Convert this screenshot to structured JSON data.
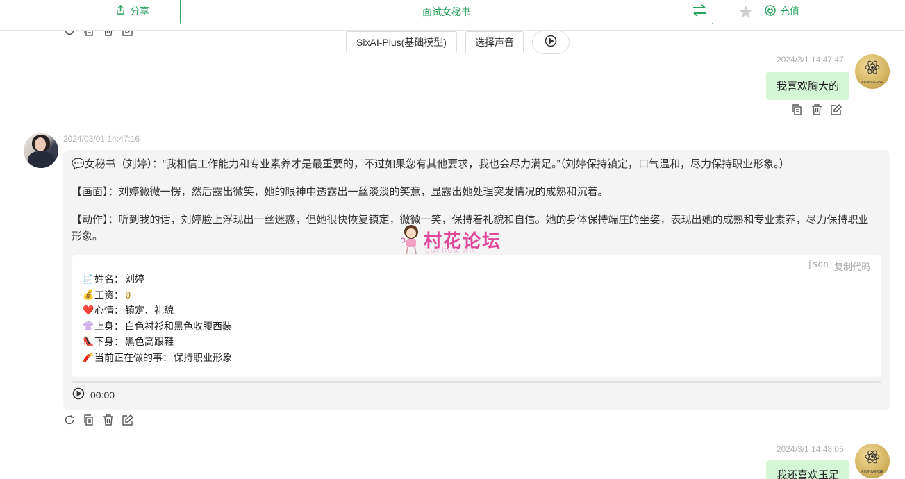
{
  "header": {
    "share_label": "分享",
    "title": "面试女秘书",
    "recharge_label": "充值"
  },
  "controls": {
    "model_label": "SixAI-Plus(基础模型)",
    "voice_label": "选择声音"
  },
  "messages": [
    {
      "role": "user",
      "time": "2024/3/1 14:47:47",
      "text": "我喜欢胸大的",
      "avatar_text": "AI UNIVERSE"
    },
    {
      "role": "assistant",
      "time": "2024/03/01 14:47:16",
      "paragraphs": [
        "💬女秘书（刘婷）：“我相信工作能力和专业素养才是最重要的，不过如果您有其他要求，我也会尽力满足。”（刘婷保持镇定，口气温和，尽力保持职业形象。）",
        "【画面】：刘婷微微一愣，然后露出微笑，她的眼神中透露出一丝淡淡的笑意，显露出她处理突发情况的成熟和沉着。",
        "【动作】：听到我的话，刘婷脸上浮现出一丝迷惑，但她很快恢复镇定，微微一笑，保持着礼貌和自信。她的身体保持端庄的坐姿，表现出她的成熟和专业素养，尽力保持职业形象。"
      ],
      "code": {
        "lang": "json",
        "copy_label": "复制代码",
        "lines": [
          {
            "emoji": "📄",
            "label": "姓名：",
            "value": "刘婷"
          },
          {
            "emoji": "💰",
            "label": "工资：",
            "value": "0"
          },
          {
            "emoji": "❤️",
            "label": "心情：",
            "value": "镇定、礼貌"
          },
          {
            "emoji": "👚",
            "label": "上身：",
            "value": "白色衬衫和黑色收腰西装"
          },
          {
            "emoji": "👠",
            "label": "下身：",
            "value": "黑色高跟鞋"
          },
          {
            "emoji": "🧨",
            "label": "当前正在做的事：",
            "value": "保持职业形象"
          }
        ]
      },
      "audio_time": "00:00"
    },
    {
      "role": "user",
      "time": "2024/3/1 14:48:05",
      "text": "我还喜欢玉足",
      "avatar_text": "AI UNIVERSE"
    }
  ],
  "watermark": {
    "text": "村花论坛",
    "sub": "cunhua.win"
  },
  "colors": {
    "accent": "#27a35c",
    "user_bubble": "#d4f6d4",
    "bot_bubble": "#f4f4f5",
    "watermark": "#e0479a"
  }
}
